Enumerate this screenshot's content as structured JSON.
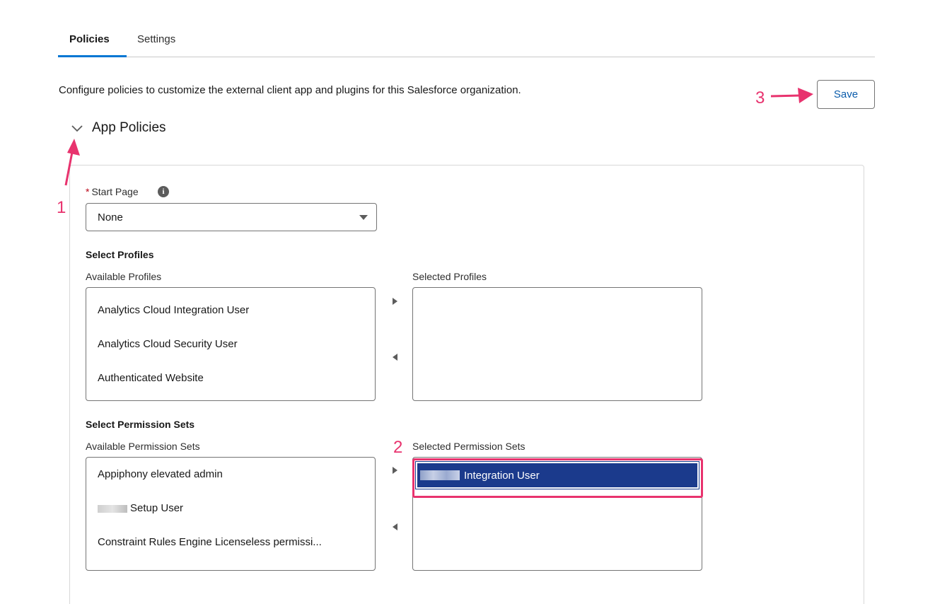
{
  "tabs": [
    {
      "label": "Policies",
      "active": true
    },
    {
      "label": "Settings",
      "active": false
    }
  ],
  "description": "Configure policies to customize the external client app and plugins for this Salesforce organization.",
  "save_label": "Save",
  "section": {
    "title": "App Policies",
    "expanded": true
  },
  "start_page": {
    "required_marker": "*",
    "label": "Start Page",
    "info_glyph": "i",
    "value": "None"
  },
  "profiles": {
    "heading": "Select Profiles",
    "available_label": "Available Profiles",
    "selected_label": "Selected Profiles",
    "available": [
      "Analytics Cloud Integration User",
      "Analytics Cloud Security User",
      "Authenticated Website"
    ],
    "selected": []
  },
  "permission_sets": {
    "heading": "Select Permission Sets",
    "available_label": "Available Permission Sets",
    "selected_label": "Selected Permission Sets",
    "available": [
      "Appiphony elevated admin",
      "Setup User",
      "Constraint Rules Engine Licenseless permissi..."
    ],
    "selected": [
      "Integration User"
    ]
  },
  "annotations": {
    "step1": "1",
    "step2": "2",
    "step3": "3"
  },
  "colors": {
    "brand_blue": "#0176d3",
    "selected_row": "#1b3a8c",
    "annotation_pink": "#e8336e",
    "required_red": "#ba0517"
  }
}
